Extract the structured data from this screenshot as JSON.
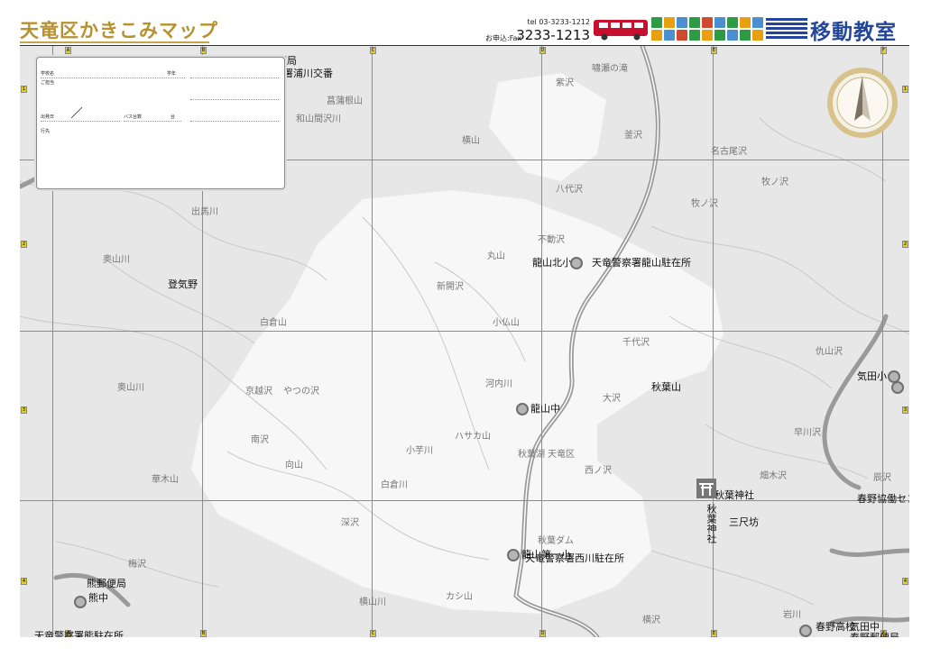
{
  "header": {
    "title": "天竜区かきこみマップ",
    "tel": "tel 03-3233-1212",
    "fax_label": "お申込:Fax",
    "fax": "3233-1213",
    "brand": "移動教室"
  },
  "form": {
    "school": "学校名",
    "grade": "学年",
    "teacher": "ご担当",
    "date": "出発日",
    "bus": "バス台数",
    "count": "台",
    "destination": "行先"
  },
  "grid": {
    "cols_top": [
      "A",
      "B",
      "C",
      "D",
      "E",
      "F"
    ],
    "cols_bottom": [
      "A",
      "B",
      "C",
      "D",
      "E",
      "F"
    ],
    "rows_left": [
      "1",
      "2",
      "3",
      "4"
    ],
    "rows_right": [
      "1",
      "2",
      "3",
      "4"
    ]
  },
  "places": {
    "gray": [
      "菖蒲根山",
      "和山間沢川",
      "嘯瀬の滝",
      "紫沢",
      "横山",
      "釜沢",
      "名古尾沢",
      "牧ノ沢",
      "八代沢",
      "牧ノ沢",
      "出馬川",
      "奥山川",
      "不動沢",
      "丸山",
      "新開沢",
      "小仏山",
      "白倉山",
      "千代沢",
      "仇山沢",
      "奥山川",
      "京越沢",
      "やつの沢",
      "河内川",
      "大沢",
      "南沢",
      "向山",
      "小芋川",
      "ハサカ山",
      "秋葉湖 天竜区",
      "西ノ沢",
      "早川沢",
      "華木山",
      "白倉川",
      "畑木沢",
      "辰沢",
      "深沢",
      "秋葉ダム",
      "カシ山",
      "横山川",
      "横沢",
      "岩川",
      "梅沢"
    ],
    "dark": [
      "浦川郵便局",
      "警察署浦川交番",
      "登気野",
      "龍山北小",
      "天竜警察署龍山駐在所",
      "龍山中",
      "秋葉山",
      "気田小",
      "秋葉神社",
      "秋葉神社",
      "三尺坊",
      "春野協働センター",
      "熊郵便局",
      "熊中",
      "龍山第一小",
      "天竜警察署西川駐在所",
      "天竜警察署熊駐在所",
      "春野高校",
      "気田中",
      "春野郵便局"
    ]
  },
  "colors": {
    "title": "#b8912f",
    "brand": "#24469a",
    "map_bg": "#e7e7e7",
    "road": "#9a9a9a"
  }
}
